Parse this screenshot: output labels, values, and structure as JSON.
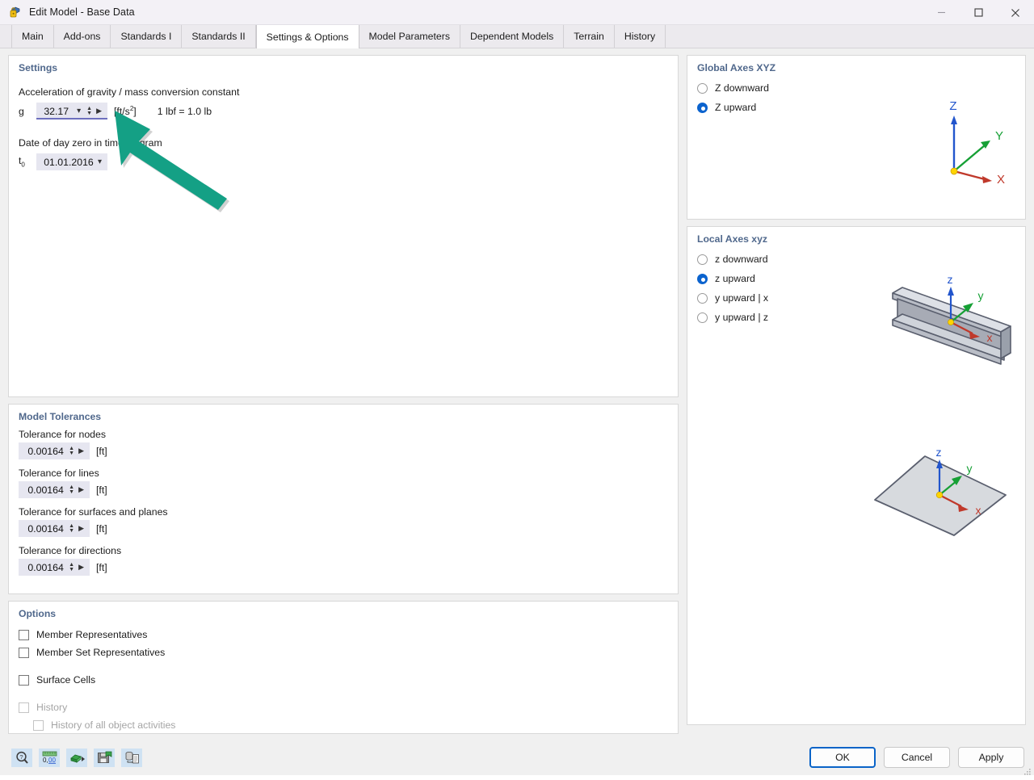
{
  "window": {
    "title": "Edit Model - Base Data",
    "icon": "model-lock-icon",
    "controls": [
      {
        "name": "minimize-button",
        "glyph": "minimize"
      },
      {
        "name": "maximize-button",
        "glyph": "maximize"
      },
      {
        "name": "close-button",
        "glyph": "close"
      }
    ]
  },
  "tabs": [
    {
      "label": "Main",
      "active": false
    },
    {
      "label": "Add-ons",
      "active": false
    },
    {
      "label": "Standards I",
      "active": false
    },
    {
      "label": "Standards II",
      "active": false
    },
    {
      "label": "Settings & Options",
      "active": true
    },
    {
      "label": "Model Parameters",
      "active": false
    },
    {
      "label": "Dependent Models",
      "active": false
    },
    {
      "label": "Terrain",
      "active": false
    },
    {
      "label": "History",
      "active": false
    }
  ],
  "settings": {
    "title": "Settings",
    "gravity_label": "Acceleration of gravity / mass conversion constant",
    "gravity_symbol": "g",
    "gravity_value": "32.17",
    "gravity_unit": "[ft/s",
    "gravity_unit_exp": "2",
    "gravity_unit_close": "]",
    "gravity_note": "1 lbf = 1.0 lb",
    "date_label": "Date of day zero in time diagram",
    "date_symbol": "t",
    "date_symbol_sub": "0",
    "date_value": "01.01.2016"
  },
  "tolerances": {
    "title": "Model Tolerances",
    "unit": "[ft]",
    "items": [
      {
        "label": "Tolerance for nodes",
        "value": "0.00164"
      },
      {
        "label": "Tolerance for lines",
        "value": "0.00164"
      },
      {
        "label": "Tolerance for surfaces and planes",
        "value": "0.00164"
      },
      {
        "label": "Tolerance for directions",
        "value": "0.00164"
      }
    ]
  },
  "options": {
    "title": "Options",
    "items": [
      {
        "label": "Member Representatives",
        "checked": false,
        "disabled": false,
        "indent": 0,
        "gap_before": 0
      },
      {
        "label": "Member Set Representatives",
        "checked": false,
        "disabled": false,
        "indent": 0,
        "gap_before": 0
      },
      {
        "label": "Surface Cells",
        "checked": false,
        "disabled": false,
        "indent": 0,
        "gap_before": 12
      },
      {
        "label": "History",
        "checked": false,
        "disabled": true,
        "indent": 0,
        "gap_before": 12
      },
      {
        "label": "History of all object activities",
        "checked": false,
        "disabled": true,
        "indent": 18,
        "gap_before": 0
      }
    ]
  },
  "global_axes": {
    "title": "Global Axes XYZ",
    "options": [
      {
        "label": "Z downward",
        "selected": false
      },
      {
        "label": "Z upward",
        "selected": true
      }
    ],
    "axis_labels": {
      "x": "X",
      "y": "Y",
      "z": "Z"
    }
  },
  "local_axes": {
    "title": "Local Axes xyz",
    "options": [
      {
        "label": "z downward",
        "selected": false
      },
      {
        "label": "z upward",
        "selected": true
      },
      {
        "label": "y upward | x",
        "selected": false
      },
      {
        "label": "y upward | z",
        "selected": false
      }
    ],
    "axis_labels": {
      "x": "x",
      "y": "y",
      "z": "z"
    }
  },
  "toolbar": {
    "items": [
      {
        "name": "help-icon",
        "title": "Help"
      },
      {
        "name": "units-ruler-icon",
        "title": "Units and decimal places"
      },
      {
        "name": "import-settings-icon",
        "title": "Import settings"
      },
      {
        "name": "save-settings-icon",
        "title": "Save settings"
      },
      {
        "name": "copy-to-clipboard-icon",
        "title": "Copy"
      }
    ]
  },
  "buttons": {
    "ok": "OK",
    "cancel": "Cancel",
    "apply": "Apply"
  },
  "annotation": {
    "type": "arrow",
    "color": "#14a085",
    "points_to": "gravity-value-field"
  },
  "colors": {
    "accent": "#0b63ce",
    "panel_title": "#50688c",
    "field_bg": "#e6e6f0",
    "focus_underline": "#6d6fbe",
    "arrow": "#14a085",
    "axis_x": "#c0392b",
    "axis_y": "#16a035",
    "axis_z": "#2255cc",
    "origin": "#ffd400"
  }
}
